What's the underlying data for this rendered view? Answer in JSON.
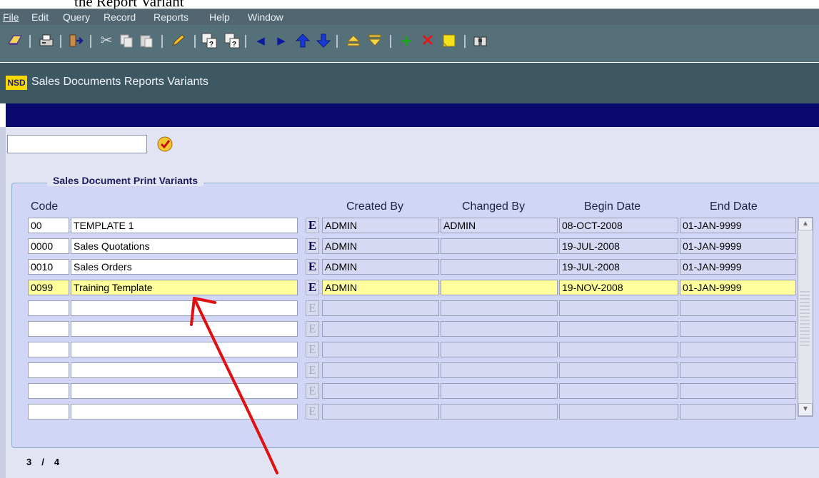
{
  "caption": "the Report Variant",
  "menu": [
    "File",
    "Edit",
    "Query",
    "Record",
    "Reports",
    "Help",
    "Window"
  ],
  "toolbar_icons": [
    "save-icon",
    "print-icon",
    "exit-icon",
    "cut-icon",
    "copy-icon",
    "paste-icon",
    "edit-icon",
    "query-enter-icon",
    "query-execute-icon",
    "previous-block-icon",
    "next-block-icon",
    "previous-record-icon",
    "next-record-icon",
    "first-record-icon",
    "last-record-icon",
    "insert-record-icon",
    "delete-record-icon",
    "note-icon",
    "find-icon"
  ],
  "form": {
    "logo": "NSD",
    "title": "Sales Documents Reports Variants",
    "search_value": ""
  },
  "group": {
    "title": "Sales Document Print Variants",
    "columns": {
      "code": "Code",
      "created_by": "Created By",
      "changed_by": "Changed By",
      "begin_date": "Begin Date",
      "end_date": "End Date"
    },
    "edit_button_label": "E",
    "rows": [
      {
        "code": "00",
        "name": "TEMPLATE 1",
        "created_by": "ADMIN",
        "changed_by": "ADMIN",
        "begin_date": "08-OCT-2008",
        "end_date": "01-JAN-9999"
      },
      {
        "code": "0000",
        "name": "Sales Quotations",
        "created_by": "ADMIN",
        "changed_by": "",
        "begin_date": "19-JUL-2008",
        "end_date": "01-JAN-9999"
      },
      {
        "code": "0010",
        "name": "Sales Orders",
        "created_by": "ADMIN",
        "changed_by": "",
        "begin_date": "19-JUL-2008",
        "end_date": "01-JAN-9999"
      },
      {
        "code": "0099",
        "name": "Training Template",
        "created_by": "ADMIN",
        "changed_by": "",
        "begin_date": "19-NOV-2008",
        "end_date": "01-JAN-9999"
      },
      {
        "code": "",
        "name": "",
        "created_by": "",
        "changed_by": "",
        "begin_date": "",
        "end_date": ""
      },
      {
        "code": "",
        "name": "",
        "created_by": "",
        "changed_by": "",
        "begin_date": "",
        "end_date": ""
      },
      {
        "code": "",
        "name": "",
        "created_by": "",
        "changed_by": "",
        "begin_date": "",
        "end_date": ""
      },
      {
        "code": "",
        "name": "",
        "created_by": "",
        "changed_by": "",
        "begin_date": "",
        "end_date": ""
      },
      {
        "code": "",
        "name": "",
        "created_by": "",
        "changed_by": "",
        "begin_date": "",
        "end_date": ""
      },
      {
        "code": "",
        "name": "",
        "created_by": "",
        "changed_by": "",
        "begin_date": "",
        "end_date": ""
      }
    ],
    "current_row": 4
  },
  "record_status": {
    "current": "3",
    "separator": "/",
    "total": "4"
  },
  "colors": {
    "menubar": "#516670",
    "titlebar": "#3d5863",
    "blue_bar": "#0a0a6e",
    "current_row": "#ffff9e",
    "annotation_arrow": "#e01010"
  }
}
